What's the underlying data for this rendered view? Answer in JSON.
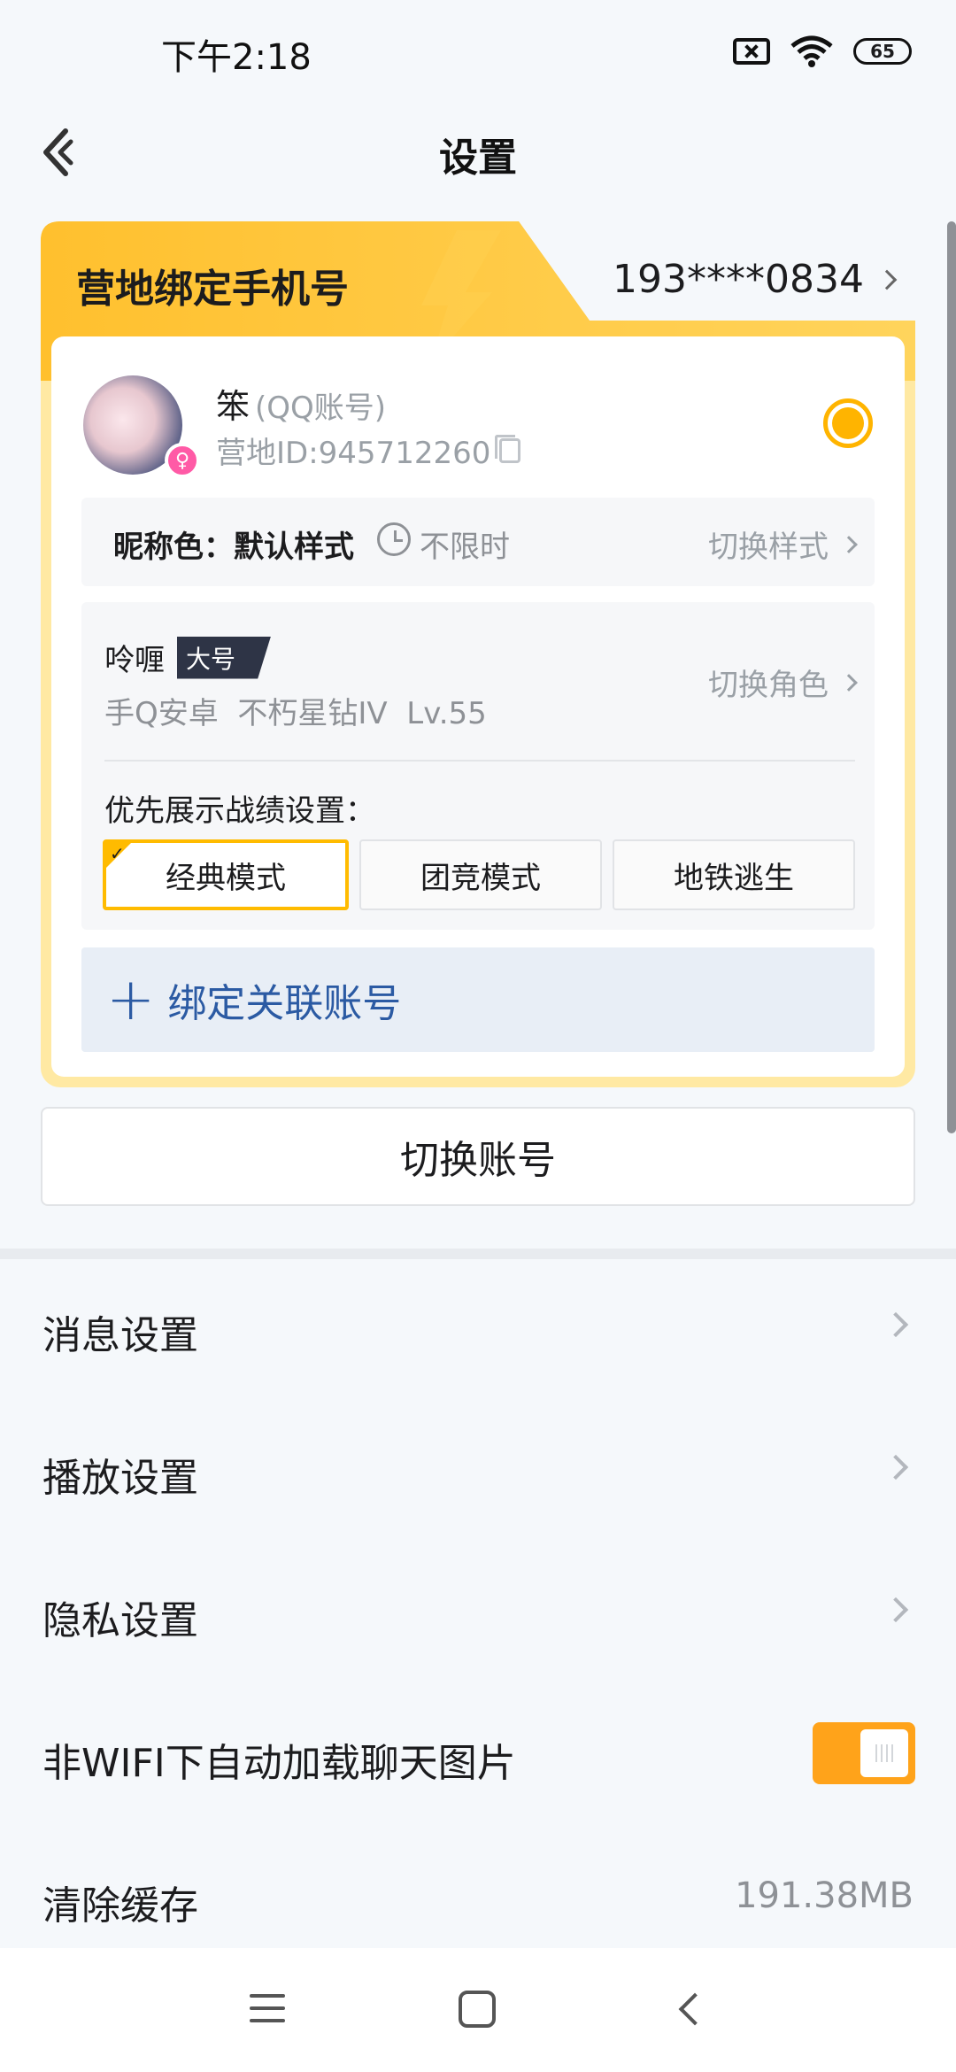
{
  "status": {
    "time": "下午2:18",
    "battery": "65"
  },
  "header": {
    "title": "设置"
  },
  "card": {
    "phone_label": "营地绑定手机号",
    "phone_number": "193****0834",
    "user": {
      "name": "笨",
      "account_type": "(QQ账号)",
      "camp_id": "营地ID:945712260"
    },
    "nickname": {
      "label": "昵称色：",
      "value": "默认样式",
      "time_limit": "不限时",
      "switch_label": "切换样式"
    },
    "role": {
      "name": "呤喱",
      "tag": "大号",
      "info": "手Q安卓  不朽星钻IV  Lv.55",
      "switch_label": "切换角色",
      "pref_label": "优先展示战绩设置：",
      "modes": [
        "经典模式",
        "团竞模式",
        "地铁逃生"
      ],
      "selected_mode": "经典模式"
    },
    "bind_label": "绑定关联账号"
  },
  "switch_account_label": "切换账号",
  "settings": [
    {
      "label": "消息设置"
    },
    {
      "label": "播放设置"
    },
    {
      "label": "隐私设置"
    },
    {
      "label": "非WIFI下自动加载聊天图片",
      "toggle_on": true
    },
    {
      "label": "清除缓存",
      "value": "191.38MB"
    }
  ],
  "colors": {
    "accent": "#ffbb00",
    "toggle": "#ffa31a",
    "link": "#2b5aa3"
  }
}
